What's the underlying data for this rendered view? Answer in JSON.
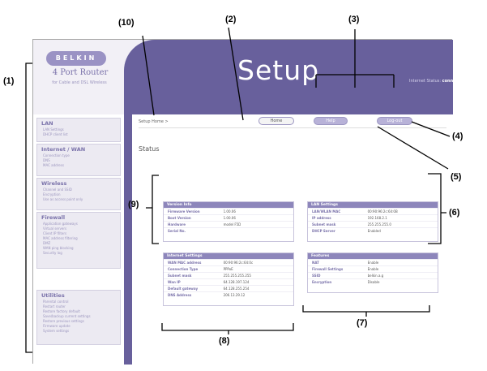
{
  "brand": {
    "logo": "BELKIN",
    "product": "4 Port Router",
    "tagline": "for Cable and DSL Wireless"
  },
  "page_heading": "Setup",
  "internet_status": {
    "label": "Internet Status:",
    "value": "connection OK"
  },
  "breadcrumb": "Setup Home >",
  "toolbar": {
    "home": "Home",
    "help": "Help",
    "logout": "Log-out"
  },
  "section_title": "Status",
  "sidebar": [
    {
      "title": "LAN",
      "items": [
        "LAN Settings",
        "DHCP client list"
      ]
    },
    {
      "title": "Internet / WAN",
      "items": [
        "Connection type",
        "DNS",
        "MAC address"
      ]
    },
    {
      "title": "Wireless",
      "items": [
        "Channel and SSID",
        "Encryption",
        "Use as access point only"
      ]
    },
    {
      "title": "Firewall",
      "items": [
        "Application gateways",
        "Virtual servers",
        "Client IP filters",
        "MAC address filtering",
        "DMZ",
        "WAN ping blocking",
        "Security log"
      ]
    },
    {
      "title": "Utilities",
      "items": [
        "Parental control",
        "Restart router",
        "Restore factory default",
        "Save/backup current settings",
        "Restore previous settings",
        "Firmware update",
        "System settings"
      ]
    }
  ],
  "panels": {
    "version_info": {
      "title": "Version Info",
      "rows": [
        {
          "label": "Firmware Version",
          "value": "1.00.06"
        },
        {
          "label": "Boot Version",
          "value": "1.00.06"
        },
        {
          "label": "Hardware",
          "value": "model F5D"
        },
        {
          "label": "Serial No.",
          "value": ""
        }
      ]
    },
    "lan_settings": {
      "title": "LAN Settings",
      "rows": [
        {
          "label": "LAN/WLAN MAC",
          "value": "00:90:96:2c:64:0B"
        },
        {
          "label": "IP address",
          "value": "192.168.2.1"
        },
        {
          "label": "Subnet mask",
          "value": "255.255.255.0"
        },
        {
          "label": "DHCP Server",
          "value": "Enabled"
        }
      ]
    },
    "internet_settings": {
      "title": "Internet Settings",
      "rows": [
        {
          "label": "WAN MAC address",
          "value": "00:90:96:2c:64:0c"
        },
        {
          "label": "Connection Type",
          "value": "PPPoE"
        },
        {
          "label": "Subnet mask",
          "value": "255.255.255.255"
        },
        {
          "label": "Wan IP",
          "value": "64.128.197.124"
        },
        {
          "label": "Default gateway",
          "value": "64.128.255.254"
        },
        {
          "label": "DNS Address",
          "value": "206.13.29.12"
        }
      ]
    },
    "features": {
      "title": "Features",
      "rows": [
        {
          "label": "NAT",
          "value": "Enable"
        },
        {
          "label": "Firewall Settings",
          "value": "Enable"
        },
        {
          "label": "SSID",
          "value": "belkin.a.g"
        },
        {
          "label": "Encryption",
          "value": "Disable"
        }
      ]
    }
  },
  "callouts": [
    "(1)",
    "(2)",
    "(3)",
    "(4)",
    "(5)",
    "(6)",
    "(7)",
    "(8)",
    "(9)",
    "(10)"
  ]
}
